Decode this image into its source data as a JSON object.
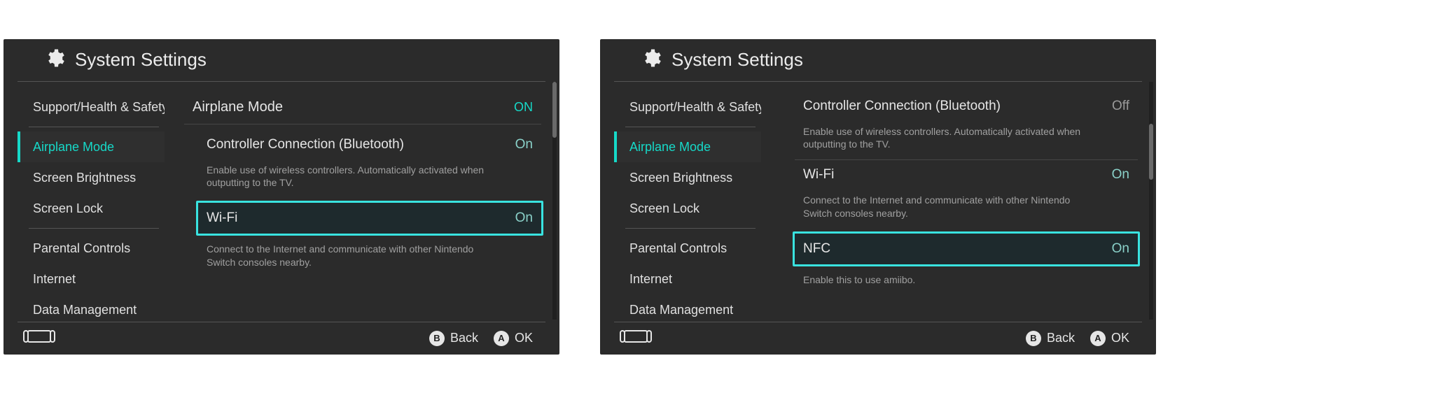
{
  "header": {
    "title": "System Settings"
  },
  "sidebar": {
    "items": [
      "Support/Health & Safety",
      "Airplane Mode",
      "Screen Brightness",
      "Screen Lock",
      "Parental Controls",
      "Internet",
      "Data Management"
    ],
    "selected_index": 1
  },
  "left_content": {
    "airplane": {
      "label": "Airplane Mode",
      "value": "ON"
    },
    "bluetooth": {
      "label": "Controller Connection (Bluetooth)",
      "value": "On",
      "desc": "Enable use of wireless controllers. Automatically activated when outputting to the TV."
    },
    "wifi": {
      "label": "Wi-Fi",
      "value": "On",
      "desc": "Connect to the Internet and communicate with other Nintendo Switch consoles nearby."
    }
  },
  "right_content": {
    "bluetooth": {
      "label": "Controller Connection (Bluetooth)",
      "value": "Off",
      "desc": "Enable use of wireless controllers. Automatically activated when outputting to the TV."
    },
    "wifi": {
      "label": "Wi-Fi",
      "value": "On",
      "desc": "Connect to the Internet and communicate with other Nintendo Switch consoles nearby."
    },
    "nfc": {
      "label": "NFC",
      "value": "On",
      "desc": "Enable this to use amiibo."
    }
  },
  "footer": {
    "b_label": "Back",
    "a_label": "OK",
    "b_key": "B",
    "a_key": "A"
  }
}
